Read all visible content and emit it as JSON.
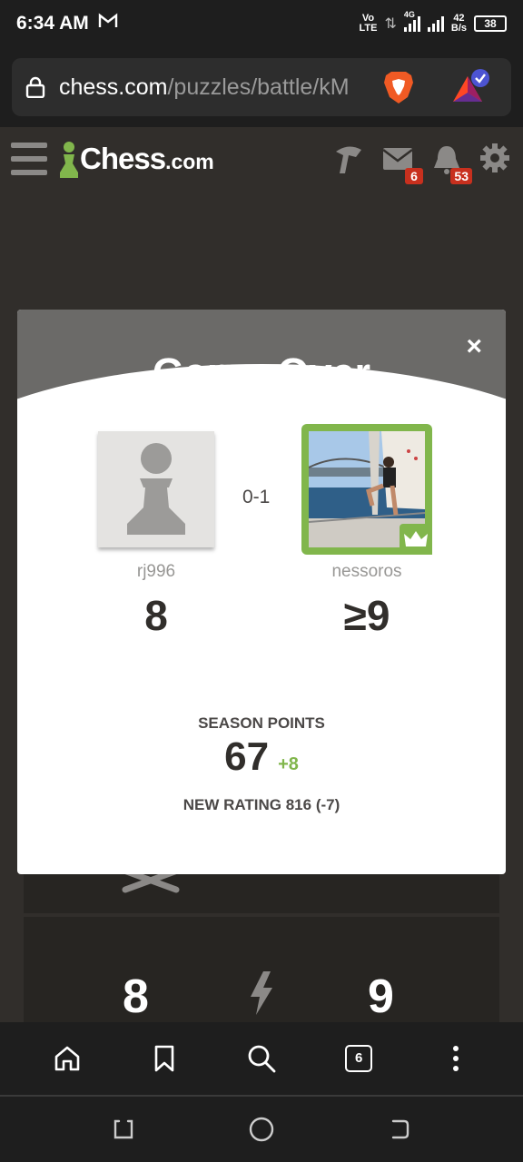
{
  "status_bar": {
    "time": "6:34 AM",
    "network_top": "Vo",
    "network_bottom": "LTE",
    "network_gen": "4G",
    "speed_value": "42",
    "speed_unit": "B/s",
    "battery": "38"
  },
  "browser": {
    "url_domain": "chess.com",
    "url_path": "/puzzles/battle/kM",
    "tab_count": "6"
  },
  "header": {
    "logo_text": "Chess",
    "logo_suffix": ".com",
    "messages_badge": "6",
    "notifications_badge": "53"
  },
  "modal": {
    "title": "Game Over",
    "close_label": "×",
    "result": "0-1",
    "player_left": {
      "name": "rj996",
      "score": "8"
    },
    "player_right": {
      "name": "nessoros",
      "score": "≥9"
    },
    "season_points_label": "SEASON POINTS",
    "season_points_value": "67",
    "season_points_delta": "+8",
    "new_rating": "NEW RATING 816 (-7)"
  },
  "background": {
    "score_left": "8",
    "score_right": "9"
  },
  "colors": {
    "accent_green": "#81b64c",
    "badge_red": "#c8301e",
    "page_bg": "#312e2b"
  }
}
